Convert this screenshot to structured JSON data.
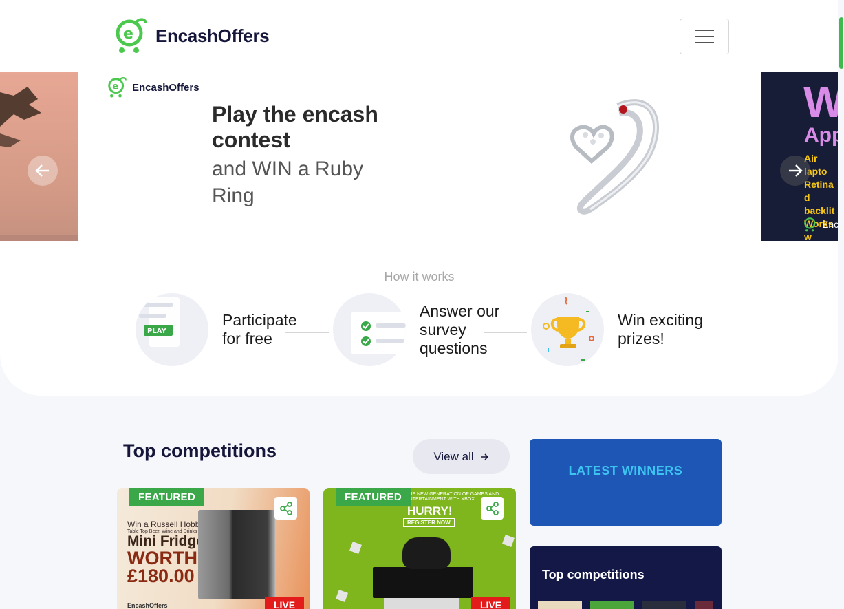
{
  "header": {
    "brand": "EncashOffers",
    "menu_icon": "hamburger-menu-icon"
  },
  "hero": {
    "slide_brand": "EncashOffers",
    "title": "Play the encash contest",
    "subtitle": "and WIN a Ruby Ring",
    "right_slide": {
      "headline": "W",
      "sub": "App",
      "lines": [
        "Air lapto",
        "Retina d",
        "backlit",
        "Works w"
      ],
      "brand": "Enc"
    },
    "prev_icon": "arrow-left-icon",
    "next_icon": "arrow-right-icon"
  },
  "how_it_works": {
    "title": "How it works",
    "steps": [
      {
        "label": "Participate for free",
        "icon": "play-card-icon",
        "badge": "PLAY"
      },
      {
        "label": "Answer our survey questions",
        "icon": "checklist-icon"
      },
      {
        "label": "Win exciting prizes!",
        "icon": "trophy-icon"
      }
    ]
  },
  "competitions": {
    "title": "Top competitions",
    "view_all": "View all",
    "cards": [
      {
        "badge": "FEATURED",
        "status": "LIVE",
        "copy": {
          "line1": "Win a Russell Hobbs",
          "line2": "Table Top Beer, Wine and Drinks",
          "line3": "Mini Fridge",
          "line4": "WORTH",
          "line5": "£180.00",
          "brand": "EncashOffers"
        }
      },
      {
        "badge": "FEATURED",
        "status": "LIVE",
        "copy": {
          "top": "THE NEW GENERATION OF GAMES AND ENTERTAINMENT WITH XBOX",
          "hurry": "HURRY!",
          "register": "REGISTER NOW"
        }
      }
    ]
  },
  "sidebar": {
    "winners_title": "LATEST WINNERS",
    "top_title": "Top competitions"
  },
  "colors": {
    "brand_green": "#3fba4e",
    "winners_blue": "#1d56b5",
    "winners_text": "#3dc3f0",
    "navy": "#141847",
    "live_red": "#e31b1b"
  }
}
